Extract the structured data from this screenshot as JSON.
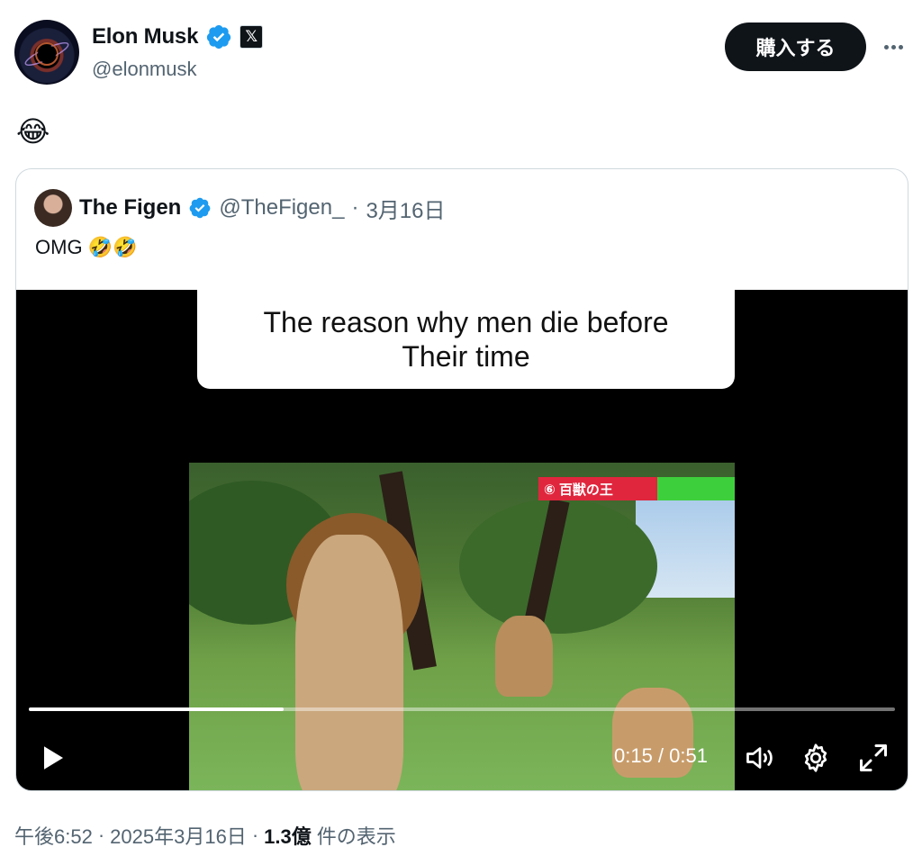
{
  "author": {
    "name": "Elon Musk",
    "handle": "@elonmusk",
    "affiliate_badge": "𝕏"
  },
  "header": {
    "buy_label": "購入する"
  },
  "tweet": {
    "text": "😂"
  },
  "quoted": {
    "name": "The Figen",
    "handle": "@TheFigen_",
    "separator": "·",
    "date": "3月16日",
    "text": "OMG 🤣🤣",
    "video": {
      "caption_line1": "The reason why men die before",
      "caption_line2": "Their time",
      "tv_tag": "⑥ 百獣の王",
      "time_display": "0:15 / 0:51",
      "progress": 0.294
    }
  },
  "footer": {
    "time": "午後6:52",
    "sep1": "·",
    "date": "2025年3月16日",
    "sep2": "·",
    "views": "1.3億",
    "views_label": "件の表示"
  },
  "colors": {
    "verified": "#1d9bf0",
    "text_primary": "#0f1419",
    "text_secondary": "#536471",
    "border": "#cfd9de"
  }
}
